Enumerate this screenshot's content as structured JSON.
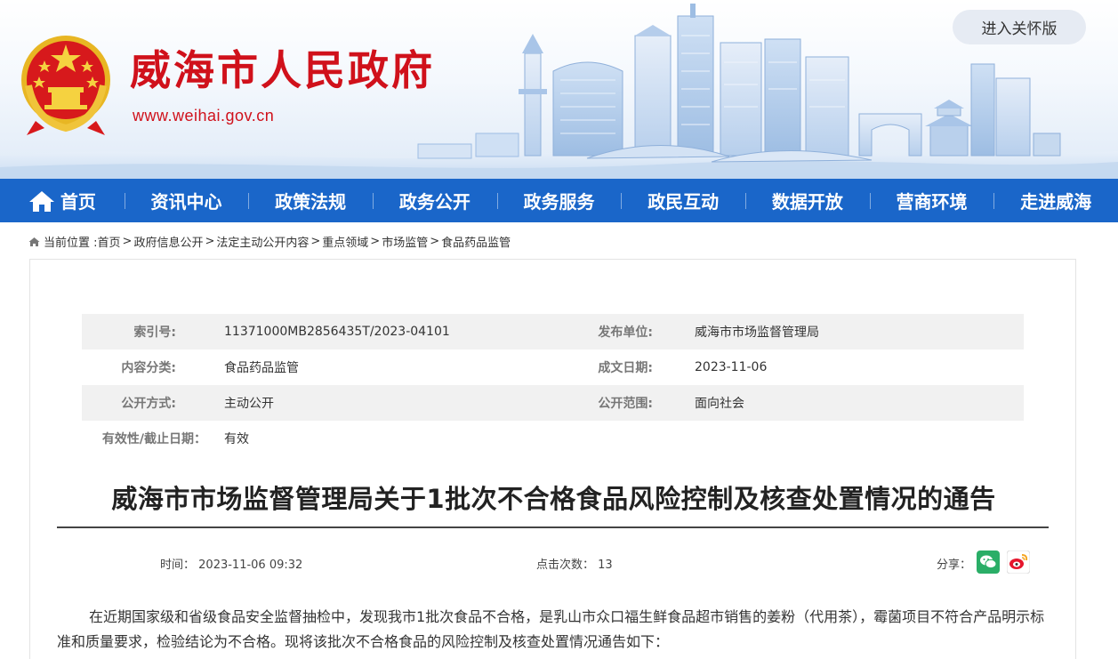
{
  "header": {
    "site_title": "威海市人民政府",
    "site_url": "www.weihai.gov.cn",
    "care_button": "进入关怀版"
  },
  "nav": {
    "items": [
      {
        "label": "首页",
        "icon": "home-icon"
      },
      {
        "label": "资讯中心"
      },
      {
        "label": "政策法规"
      },
      {
        "label": "政务公开"
      },
      {
        "label": "政务服务"
      },
      {
        "label": "政民互动"
      },
      {
        "label": "数据开放"
      },
      {
        "label": "营商环境"
      },
      {
        "label": "走进威海"
      }
    ]
  },
  "breadcrumb": {
    "prefix": "当前位置 :",
    "items": [
      "首页",
      "政府信息公开",
      "法定主动公开内容",
      "重点领域",
      "市场监管",
      "食品药品监管"
    ]
  },
  "meta": {
    "index_label": "索引号:",
    "index_value": "11371000MB2856435T/2023-04101",
    "publisher_label": "发布单位:",
    "publisher_value": "威海市市场监督管理局",
    "category_label": "内容分类:",
    "category_value": "食品药品监管",
    "date_label": "成文日期:",
    "date_value": "2023-11-06",
    "method_label": "公开方式:",
    "method_value": "主动公开",
    "scope_label": "公开范围:",
    "scope_value": "面向社会",
    "validity_label": "有效性/截止日期：",
    "validity_value": "有效"
  },
  "article": {
    "title": "威海市市场监督管理局关于1批次不合格食品风险控制及核查处置情况的通告",
    "time_label": "时间：",
    "time_value": "2023-11-06 09:32",
    "clicks_label": "点击次数：",
    "clicks_value": "13",
    "share_label": "分享：",
    "paragraph1": "在近期国家级和省级食品安全监督抽检中，发现我市1批次食品不合格，是乳山市众口福生鲜食品超市销售的姜粉（代用茶），霉菌项目不符合产品明示标准和质量要求，检验结论为不合格。现将该批次不合格食品的风险控制及核查处置情况通告如下："
  },
  "colors": {
    "brand_red": "#d0111b",
    "nav_blue": "#1a66c9"
  }
}
